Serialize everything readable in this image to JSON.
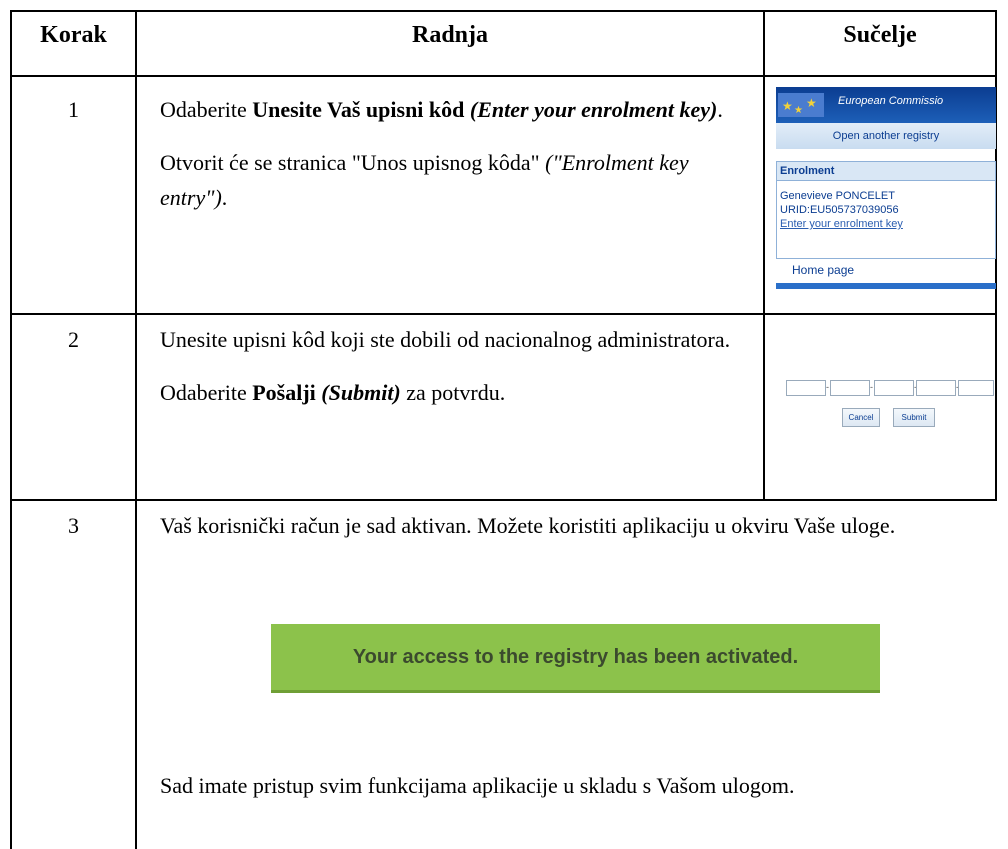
{
  "headers": {
    "step": "Korak",
    "action": "Radnja",
    "interface": "Sučelje"
  },
  "rows": [
    {
      "step": "1",
      "a_prefix": "Odaberite ",
      "a_bold": "Unesite Vaš upisni kôd",
      "a_bolditalic": " (Enter your enrolment key)",
      "a_suffix": ".",
      "b_text": "Otvorit će se stranica \"Unos upisnog kôda\" ",
      "b_italic": "(\"Enrolment key entry\")",
      "b_suffix": "."
    },
    {
      "step": "2",
      "line1": "Unesite upisni kôd koji ste dobili od nacionalnog administratora.",
      "c_prefix": "Odaberite ",
      "c_bold": "Pošalji",
      "c_bolditalic": " (Submit)",
      "c_suffix": " za potvrdu."
    },
    {
      "step": "3",
      "line1": "Vaš korisnički račun je sad aktivan. Možete koristiti aplikaciju u okviru Vaše uloge.",
      "banner": "Your access to the registry has been activated.",
      "line2": "Sad imate pristup svim funkcijama aplikacije u skladu s Vašom ulogom."
    }
  ],
  "screenshot1": {
    "banner_text": "European Commissio",
    "open_registry": "Open another registry",
    "enrolment_title": "Enrolment",
    "user_name": "Genevieve PONCELET",
    "urid": "URID:EU505737039056",
    "enrol_link": "Enter your enrolment key",
    "home": "Home page"
  },
  "screenshot2": {
    "cancel": "Cancel",
    "submit": "Submit",
    "separator": "-"
  },
  "colors": {
    "banner_green": "#8cc24b",
    "ec_blue": "#0b3d91"
  }
}
